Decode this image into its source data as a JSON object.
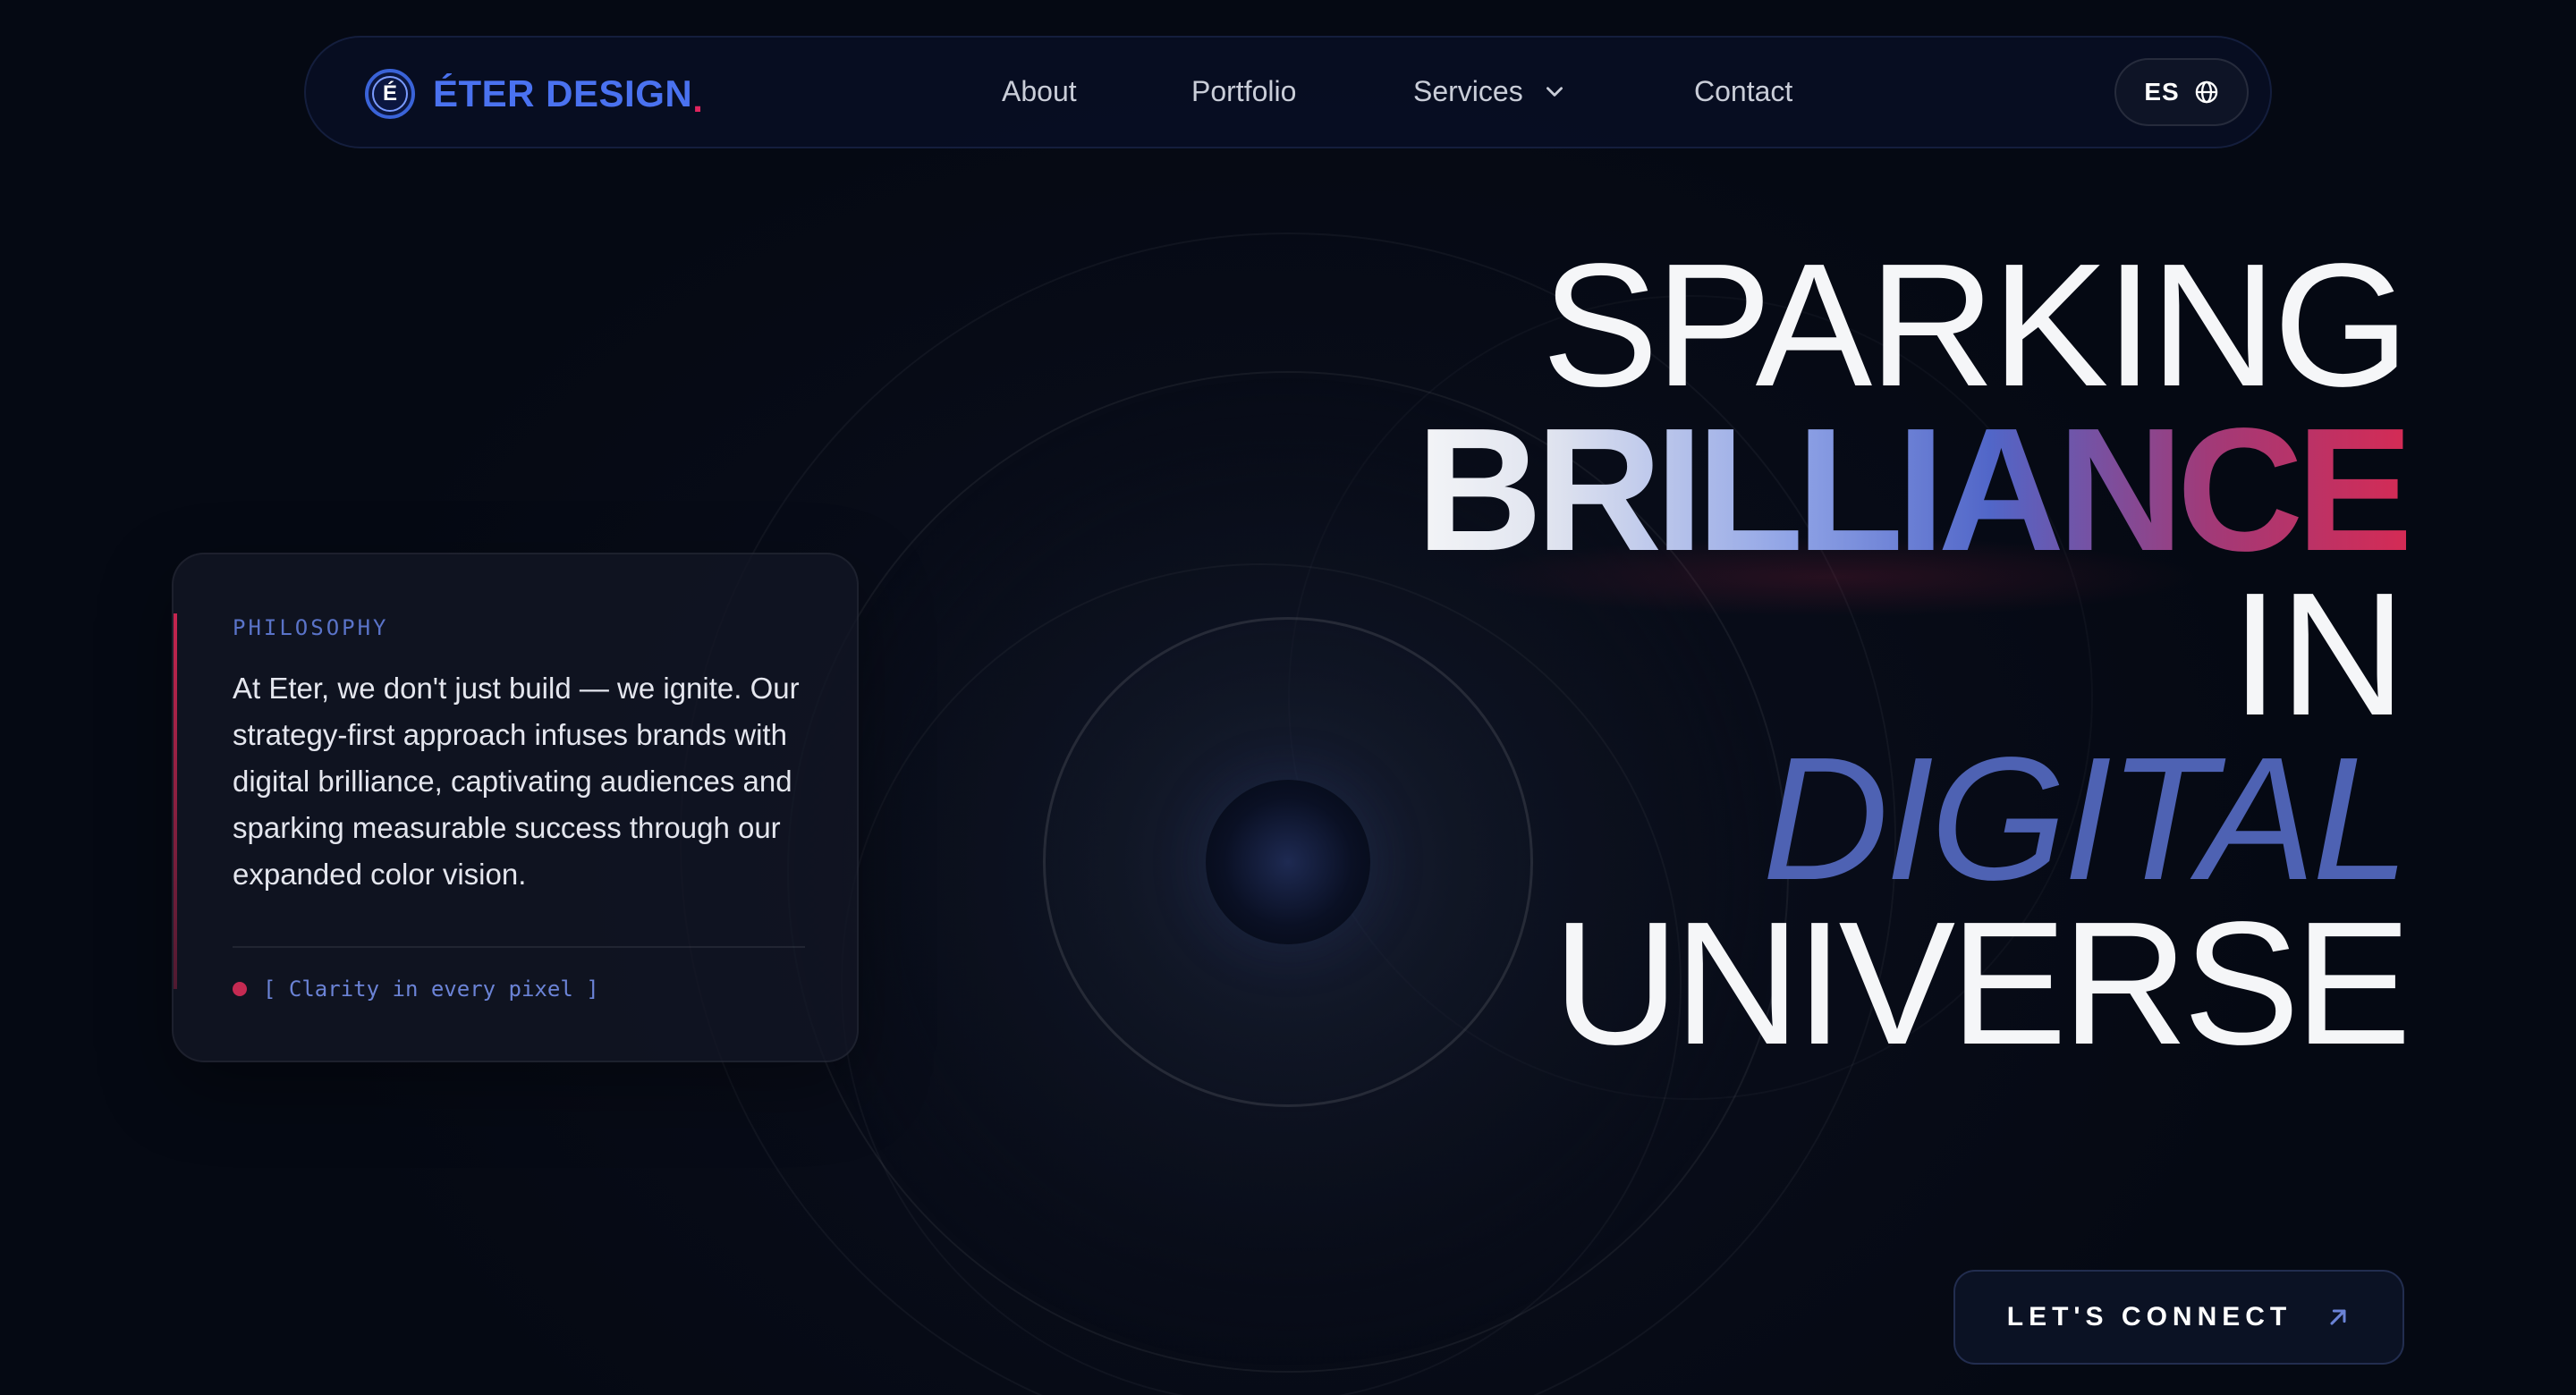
{
  "nav": {
    "brand_icon_letter": "É",
    "brand_name": "ÉTER DESIGN",
    "brand_dot": ".",
    "links": {
      "about": "About",
      "portfolio": "Portfolio",
      "services": "Services",
      "contact": "Contact"
    },
    "language": "ES",
    "icons": {
      "services_dropdown": "chevron-down-icon",
      "language": "globe-icon"
    }
  },
  "philosophy": {
    "kicker": "PHILOSOPHY",
    "text": "At Eter, we don't just build — we ignite. Our strategy-first approach infuses brands with digital brilliance, captivating audiences and sparking measurable success through our expanded color vision.",
    "tag": "[ Clarity in every pixel ]"
  },
  "headline": {
    "line1": "SPARKING",
    "line2": "BRILLIANCE",
    "line3": "IN",
    "line4": "DIGITAL",
    "line5": "UNIVERSE"
  },
  "cta": {
    "label": "LET'S CONNECT",
    "icon": "arrow-up-right-icon"
  },
  "colors": {
    "background": "#050913",
    "brand_blue": "#4a72f0",
    "accent_red": "#d42b55",
    "digital_blue": "#4e62b3",
    "mono_blue": "#6b83d6"
  }
}
